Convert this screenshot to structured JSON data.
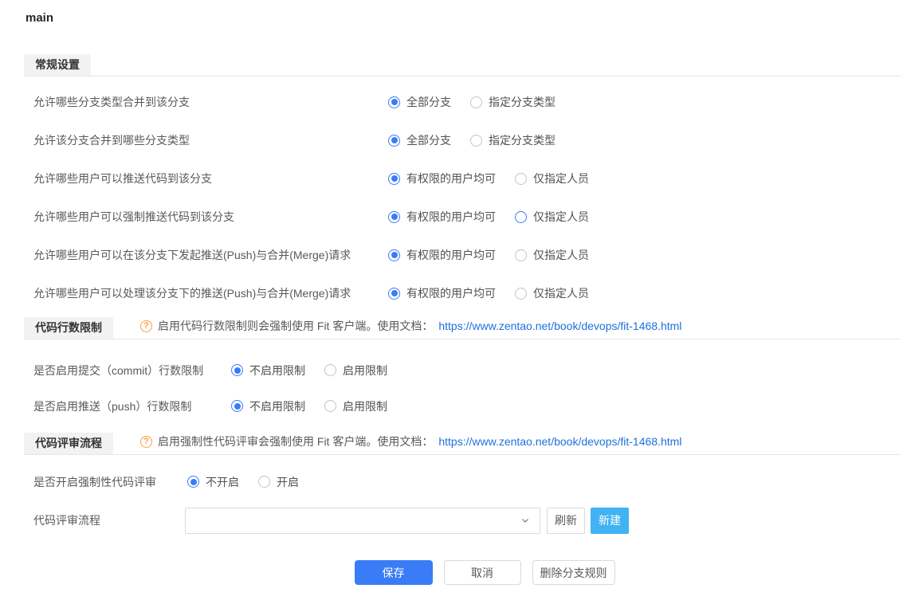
{
  "page": {
    "title": "main"
  },
  "colors": {
    "primary": "#3a7cf7",
    "light_blue": "#41b2f2",
    "link": "#2070dd",
    "help_orange": "#ff9d3c"
  },
  "sections": [
    {
      "tab": "常规设置",
      "rows": [
        {
          "label": "允许哪些分支类型合并到该分支",
          "options": [
            {
              "label": "全部分支",
              "state": "checked"
            },
            {
              "label": "指定分支类型",
              "state": "unchecked"
            }
          ]
        },
        {
          "label": "允许该分支合并到哪些分支类型",
          "options": [
            {
              "label": "全部分支",
              "state": "checked"
            },
            {
              "label": "指定分支类型",
              "state": "unchecked"
            }
          ]
        },
        {
          "label": "允许哪些用户可以推送代码到该分支",
          "options": [
            {
              "label": "有权限的用户均可",
              "state": "checked"
            },
            {
              "label": "仅指定人员",
              "state": "unchecked"
            }
          ]
        },
        {
          "label": "允许哪些用户可以强制推送代码到该分支",
          "options": [
            {
              "label": "有权限的用户均可",
              "state": "checked"
            },
            {
              "label": "仅指定人员",
              "state": "focus"
            }
          ]
        },
        {
          "label": "允许哪些用户可以在该分支下发起推送(Push)与合并(Merge)请求",
          "options": [
            {
              "label": "有权限的用户均可",
              "state": "checked"
            },
            {
              "label": "仅指定人员",
              "state": "unchecked"
            }
          ]
        },
        {
          "label": "允许哪些用户可以处理该分支下的推送(Push)与合并(Merge)请求",
          "options": [
            {
              "label": "有权限的用户均可",
              "state": "checked"
            },
            {
              "label": "仅指定人员",
              "state": "unchecked"
            }
          ]
        }
      ]
    },
    {
      "tab": "代码行数限制",
      "help": {
        "icon": "question-circle",
        "text": "启用代码行数限制则会强制使用 Fit 客户端。使用文档：",
        "link": "https://www.zentao.net/book/devops/fit-1468.html"
      },
      "rows": [
        {
          "label": "是否启用提交（commit）行数限制",
          "options": [
            {
              "label": "不启用限制",
              "state": "checked"
            },
            {
              "label": "启用限制",
              "state": "unchecked"
            }
          ]
        },
        {
          "label": "是否启用推送（push）行数限制",
          "options": [
            {
              "label": "不启用限制",
              "state": "checked"
            },
            {
              "label": "启用限制",
              "state": "unchecked"
            }
          ]
        }
      ]
    },
    {
      "tab": "代码评审流程",
      "help": {
        "icon": "question-circle",
        "text": "启用强制性代码评审会强制使用 Fit 客户端。使用文档：",
        "link": "https://www.zentao.net/book/devops/fit-1468.html"
      },
      "rows": [
        {
          "label": "是否开启强制性代码评审",
          "options": [
            {
              "label": "不开启",
              "state": "checked"
            },
            {
              "label": "开启",
              "state": "unchecked"
            }
          ]
        }
      ],
      "flow_row": {
        "label": "代码评审流程",
        "select_value": "",
        "refresh_label": "刷新",
        "create_label": "新建"
      }
    }
  ],
  "footer": {
    "save": "保存",
    "cancel": "取消",
    "delete": "删除分支规则"
  }
}
